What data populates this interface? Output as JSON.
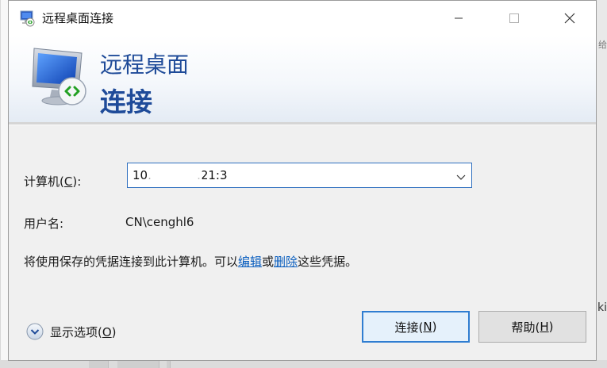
{
  "window": {
    "title": "远程桌面连接",
    "minimize_icon": "minimize-icon",
    "maximize_icon": "maximize-icon",
    "close_icon": "close-icon"
  },
  "header": {
    "line1": "远程桌面",
    "line2": "连接",
    "icon": "remote-desktop-monitor-icon"
  },
  "form": {
    "computer_label_prefix": "计算机(",
    "computer_label_key": "C",
    "computer_label_suffix": "):",
    "computer_value": "10.            .21:3",
    "username_label": "用户名:",
    "username_value": "CN\\cenghl6",
    "info_prefix": "将使用保存的凭据连接到此计算机。可以",
    "edit_link": "编辑",
    "info_middle": "或",
    "delete_link": "删除",
    "info_suffix": "这些凭据。"
  },
  "footer": {
    "options_prefix": "显示选项(",
    "options_key": "O",
    "options_suffix": ")",
    "connect_prefix": "连接(",
    "connect_key": "N",
    "connect_suffix": ")",
    "help_prefix": "帮助(",
    "help_key": "H",
    "help_suffix": ")"
  },
  "background": {
    "right_fragment_1": "给",
    "right_fragment_2": "ki"
  },
  "colors": {
    "accent": "#1f4b99",
    "link": "#0b5fbf",
    "focus": "#2f7dd1"
  }
}
